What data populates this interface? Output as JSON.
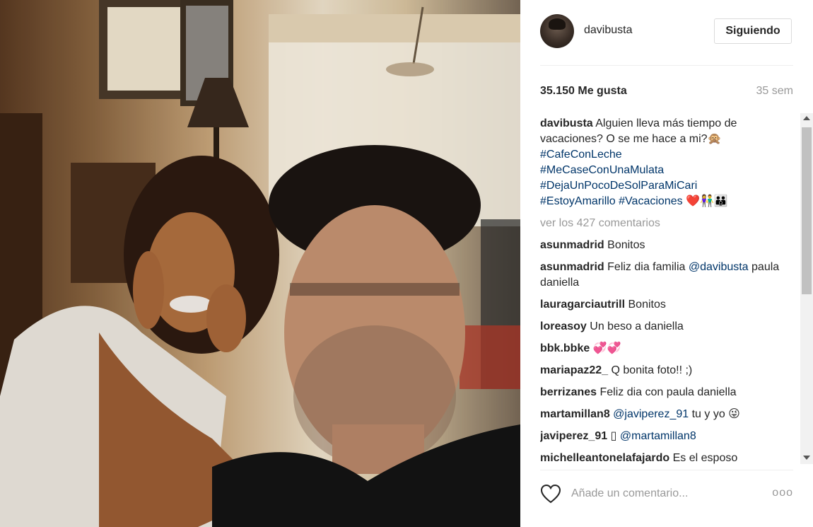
{
  "post": {
    "username": "davibusta",
    "follow_label": "Siguiendo",
    "likes": "35.150 Me gusta",
    "age": "35 sem"
  },
  "caption": {
    "user": "davibusta",
    "text": "Alguien lleva más tiempo de vacaciones? O se me hace a mi?🙊",
    "hashtags": [
      "#CafeConLeche",
      "#MeCaseConUnaMulata",
      "#DejaUnPocoDeSolParaMiCari"
    ],
    "last_line_tags": [
      "#EstoyAmarillo",
      "#Vacaciones"
    ],
    "emojis": "❤️👫👪"
  },
  "view_more": "ver los 427 comentarios",
  "comments": [
    {
      "user": "asunmadrid",
      "text": "Bonitos"
    },
    {
      "user": "asunmadrid",
      "text": "Feliz dia familia ",
      "mention": "@davibusta",
      "after": " paula daniella"
    },
    {
      "user": "lauragarciautrill",
      "text": "Bonitos"
    },
    {
      "user": "loreasoy",
      "text": "Un beso a daniella"
    },
    {
      "user": "bbk.bbke",
      "text": "💞💞"
    },
    {
      "user": "mariapaz22_",
      "text": "Q bonita foto!! ;)"
    },
    {
      "user": "berrizanes",
      "text": "Feliz dia con paula daniella"
    },
    {
      "user": "martamillan8",
      "text": "",
      "mention": "@javiperez_91",
      "after": " tu y yo 😜"
    },
    {
      "user": "javiperez_91",
      "text": "▯ ",
      "mention": "@martamillan8",
      "after": ""
    },
    {
      "user": "michelleantonelafajardo",
      "text": "Es el esposo"
    }
  ],
  "composer": {
    "placeholder": "Añade un comentario...",
    "options": "ooo"
  },
  "colors": {
    "link": "#003569",
    "muted": "#999999",
    "text": "#262626",
    "border": "#dbdbdb"
  },
  "icons": [
    "heart-icon",
    "scroll-up-icon",
    "scroll-down-icon",
    "more-options-icon"
  ]
}
